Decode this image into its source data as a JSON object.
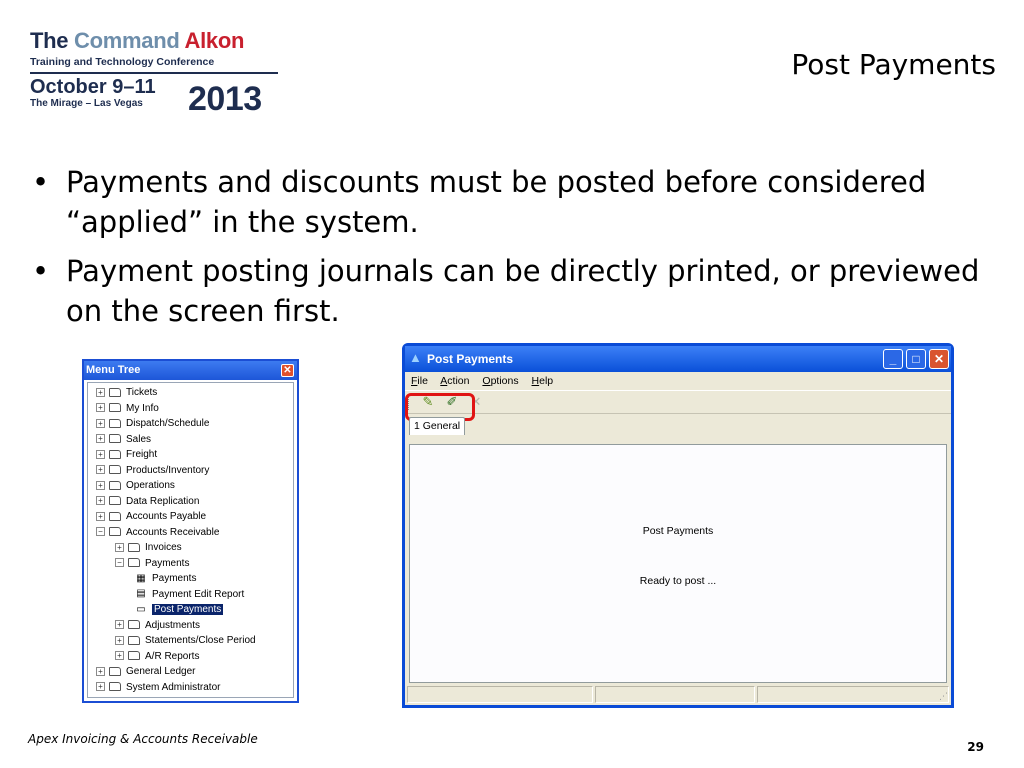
{
  "logo": {
    "the": "The",
    "command": "Command",
    "alkon": "Alkon",
    "subtitle": "Training and Technology Conference",
    "dates": "October 9–11",
    "venue": "The Mirage – Las Vegas",
    "year": "2013"
  },
  "slide": {
    "title": "Post Payments",
    "bullets": [
      "Payments and discounts must be posted before considered “applied” in the system.",
      "Payment posting journals can be directly printed, or previewed on the screen first."
    ],
    "bullet_symbol": "•",
    "footer": "Apex Invoicing & Accounts Receivable",
    "page_number": "29"
  },
  "menu_tree": {
    "title": "Menu Tree",
    "close_symbol": "✕",
    "expand_symbol": "+",
    "collapse_symbol": "−",
    "items": [
      {
        "label": "Tickets"
      },
      {
        "label": "My Info"
      },
      {
        "label": "Dispatch/Schedule"
      },
      {
        "label": "Sales"
      },
      {
        "label": "Freight"
      },
      {
        "label": "Products/Inventory"
      },
      {
        "label": "Operations"
      },
      {
        "label": "Data Replication"
      },
      {
        "label": "Accounts Payable"
      },
      {
        "label": "Accounts Receivable",
        "expanded": true
      },
      {
        "label": "Invoices"
      },
      {
        "label": "Payments",
        "expanded": true
      },
      {
        "label": "Payments",
        "icon": "payments-icon"
      },
      {
        "label": "Payment Edit Report",
        "icon": "report-icon"
      },
      {
        "label": "Post Payments",
        "icon": "form-icon",
        "selected": true
      },
      {
        "label": "Adjustments"
      },
      {
        "label": "Statements/Close Period"
      },
      {
        "label": "A/R Reports"
      },
      {
        "label": "General Ledger"
      },
      {
        "label": "System Administrator"
      }
    ]
  },
  "post_payments_window": {
    "title": "Post Payments",
    "menu": {
      "file": {
        "accel": "F",
        "rest": "ile"
      },
      "action": {
        "accel": "A",
        "rest": "ction"
      },
      "options": {
        "accel": "O",
        "rest": "ptions"
      },
      "help": {
        "accel": "H",
        "rest": "elp"
      }
    },
    "toolbar_icons": [
      "post-icon",
      "print-preview-icon",
      "cancel-icon"
    ],
    "tab": "1 General",
    "panel_title": "Post Payments",
    "status_message": "Ready to post ...",
    "highlight_color": "#e01414"
  }
}
